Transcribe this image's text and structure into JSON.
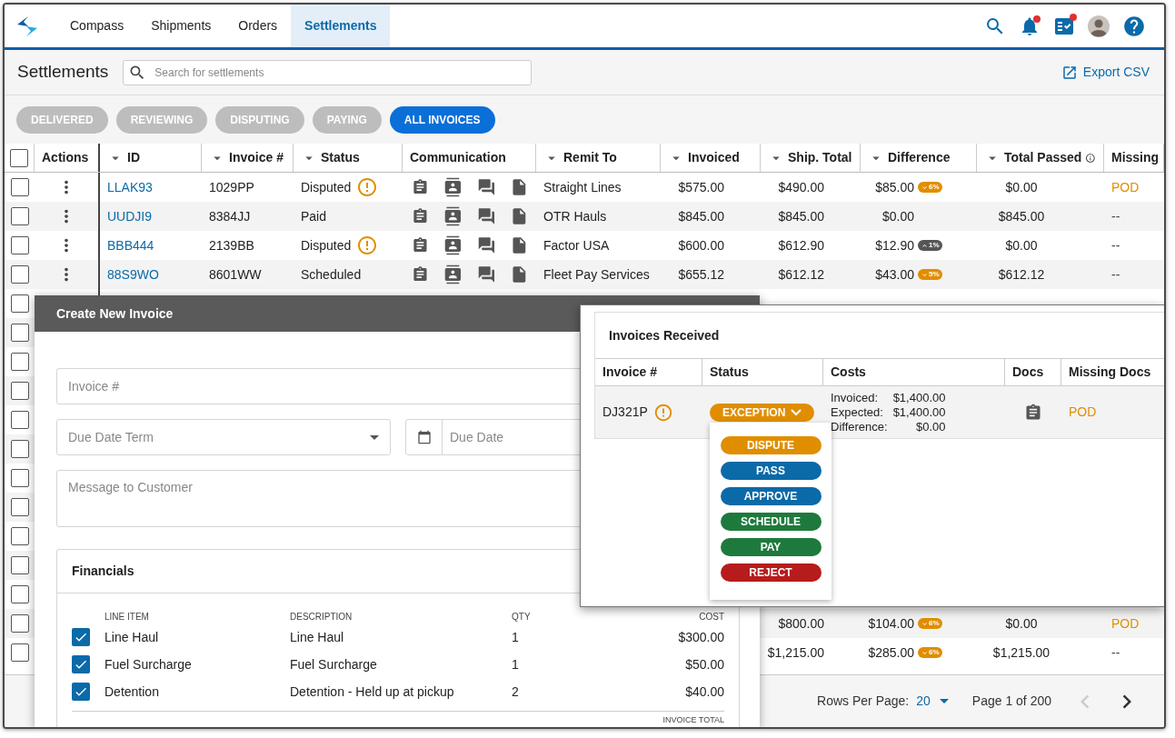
{
  "nav": {
    "tabs": [
      {
        "label": "Compass",
        "selected": false
      },
      {
        "label": "Shipments",
        "selected": false
      },
      {
        "label": "Orders",
        "selected": false
      },
      {
        "label": "Settlements",
        "selected": true
      }
    ],
    "notifications_dot": true,
    "tasks_dot": true
  },
  "page": {
    "title": "Settlements",
    "search_placeholder": "Search for settlements",
    "export": "Export CSV"
  },
  "filters": [
    {
      "label": "DELIVERED",
      "selected": false
    },
    {
      "label": "REVIEWING",
      "selected": false
    },
    {
      "label": "DISPUTING",
      "selected": false
    },
    {
      "label": "PAYING",
      "selected": false
    },
    {
      "label": "ALL INVOICES",
      "selected": true
    }
  ],
  "table": {
    "select_all": {
      "checked": false
    },
    "columns": [
      {
        "label": "Actions",
        "sortable": false
      },
      {
        "label": "ID",
        "sortable": true
      },
      {
        "label": "Invoice #",
        "sortable": true
      },
      {
        "label": "Status",
        "sortable": true
      },
      {
        "label": "Communication",
        "sortable": false
      },
      {
        "label": "Remit To",
        "sortable": true
      },
      {
        "label": "Invoiced",
        "sortable": true
      },
      {
        "label": "Ship. Total",
        "sortable": true
      },
      {
        "label": "Difference",
        "sortable": true
      },
      {
        "label": "Total Passed",
        "sortable": true,
        "info": true
      },
      {
        "label": "Missing",
        "sortable": false
      }
    ],
    "rows": [
      {
        "checked": false,
        "id": "LLAK93",
        "invoice": "1029PP",
        "status": "Disputed",
        "warning": true,
        "remit_to": "Straight Lines",
        "invoiced": "$575.00",
        "ship_total": "$490.00",
        "difference": "$85.00",
        "diff_badge": {
          "text": "6%",
          "kind": "down",
          "color": "#e08e00"
        },
        "total_passed": "$0.00",
        "missing": {
          "text": "POD",
          "alert": true
        }
      },
      {
        "checked": false,
        "id": "UUDJI9",
        "invoice": "8384JJ",
        "status": "Paid",
        "warning": false,
        "remit_to": "OTR Hauls",
        "invoiced": "$845.00",
        "ship_total": "$845.00",
        "difference": "$0.00",
        "total_passed": "$845.00",
        "missing": {
          "text": "--",
          "alert": false
        }
      },
      {
        "checked": false,
        "id": "BBB444",
        "invoice": "2139BB",
        "status": "Disputed",
        "warning": true,
        "remit_to": "Factor USA",
        "invoiced": "$600.00",
        "ship_total": "$612.90",
        "difference": "$12.90",
        "diff_badge": {
          "text": "1%",
          "kind": "up",
          "color": "#555555"
        },
        "total_passed": "$0.00",
        "missing": {
          "text": "--",
          "alert": false
        }
      },
      {
        "checked": false,
        "id": "88S9WO",
        "invoice": "8601WW",
        "status": "Scheduled",
        "warning": false,
        "remit_to": "Fleet Pay Services",
        "invoiced": "$655.12",
        "ship_total": "$612.12",
        "difference": "$43.00",
        "diff_badge": {
          "text": "5%",
          "kind": "down",
          "color": "#e08e00"
        },
        "total_passed": "$612.12",
        "missing": {
          "text": "--",
          "alert": false
        }
      },
      {
        "checked": false
      },
      {
        "checked": false
      },
      {
        "checked": false
      },
      {
        "checked": false
      },
      {
        "checked": false
      },
      {
        "checked": false
      },
      {
        "checked": false
      },
      {
        "checked": false
      },
      {
        "checked": false
      },
      {
        "checked": false
      },
      {
        "checked": false
      },
      {
        "checked": false,
        "ship_total": "$800.00",
        "difference": "$104.00",
        "diff_badge": {
          "text": "6%",
          "kind": "down",
          "color": "#e08e00"
        },
        "total_passed": "$0.00",
        "missing": {
          "text": "POD",
          "alert": true
        }
      },
      {
        "checked": false,
        "ship_total": "$1,215.00",
        "difference": "$285.00",
        "diff_badge": {
          "text": "6%",
          "kind": "down",
          "color": "#e08e00"
        },
        "total_passed": "$1,215.00",
        "missing": {
          "text": "--",
          "alert": false
        }
      }
    ]
  },
  "pagination": {
    "rows_per_page_label": "Rows Per Page:",
    "rows_per_page": "20",
    "page": "Page 1 of 200",
    "prev_disabled": true,
    "next_disabled": false
  },
  "create_invoice": {
    "title": "Create New Invoice",
    "invoice_placeholder": "Invoice #",
    "due_term_placeholder": "Due Date Term",
    "due_date_placeholder": "Due Date",
    "message_placeholder": "Message to Customer",
    "financials": {
      "title": "Financials",
      "columns": [
        "LINE ITEM",
        "DESCRIPTION",
        "QTY",
        "COST"
      ],
      "items": [
        {
          "checked": true,
          "name": "Line Haul",
          "description": "Line Haul",
          "qty": "1",
          "cost": "$300.00"
        },
        {
          "checked": true,
          "name": "Fuel Surcharge",
          "description": "Fuel Surcharge",
          "qty": "1",
          "cost": "$50.00"
        },
        {
          "checked": true,
          "name": "Detention",
          "description": "Detention - Held up at pickup",
          "qty": "2",
          "cost": "$40.00"
        }
      ],
      "total_label": "INVOICE TOTAL"
    }
  },
  "invoices_received": {
    "title": "Invoices Received",
    "columns": [
      "Invoice #",
      "Status",
      "Costs",
      "Docs",
      "Missing Docs"
    ],
    "row": {
      "invoice": "DJ321P",
      "warning": true,
      "status": {
        "label": "EXCEPTION",
        "color": "#e08e00",
        "expanded": true
      },
      "costs": [
        {
          "label": "Invoiced:",
          "value": "$1,400.00"
        },
        {
          "label": "Expected:",
          "value": "$1,400.00"
        },
        {
          "label": "Difference:",
          "value": "$0.00"
        }
      ],
      "missing": {
        "text": "POD",
        "alert": true
      }
    },
    "status_options": [
      {
        "label": "DISPUTE",
        "color": "#e08e00"
      },
      {
        "label": "PASS",
        "color": "#0b6aa8"
      },
      {
        "label": "APPROVE",
        "color": "#0b6aa8"
      },
      {
        "label": "SCHEDULE",
        "color": "#1e7a3c"
      },
      {
        "label": "PAY",
        "color": "#1e7a3c"
      },
      {
        "label": "REJECT",
        "color": "#b71c1c"
      }
    ]
  }
}
